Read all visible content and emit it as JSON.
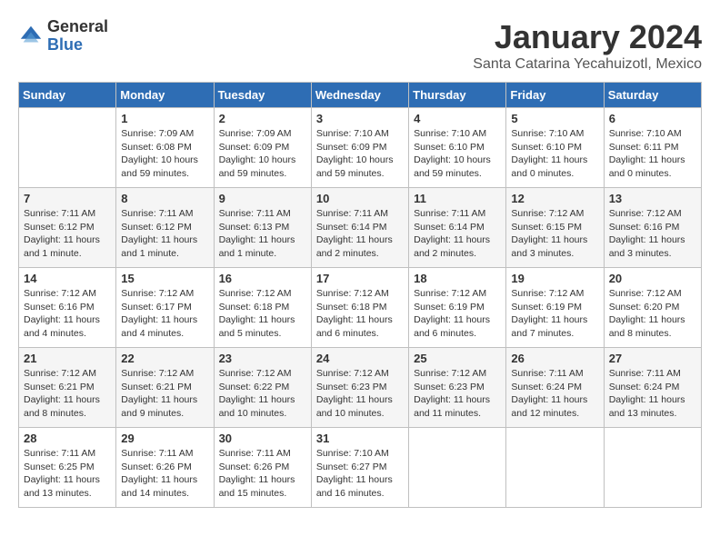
{
  "logo": {
    "general": "General",
    "blue": "Blue"
  },
  "header": {
    "month": "January 2024",
    "location": "Santa Catarina Yecahuizotl, Mexico"
  },
  "weekdays": [
    "Sunday",
    "Monday",
    "Tuesday",
    "Wednesday",
    "Thursday",
    "Friday",
    "Saturday"
  ],
  "weeks": [
    [
      {
        "day": "",
        "info": ""
      },
      {
        "day": "1",
        "info": "Sunrise: 7:09 AM\nSunset: 6:08 PM\nDaylight: 10 hours\nand 59 minutes."
      },
      {
        "day": "2",
        "info": "Sunrise: 7:09 AM\nSunset: 6:09 PM\nDaylight: 10 hours\nand 59 minutes."
      },
      {
        "day": "3",
        "info": "Sunrise: 7:10 AM\nSunset: 6:09 PM\nDaylight: 10 hours\nand 59 minutes."
      },
      {
        "day": "4",
        "info": "Sunrise: 7:10 AM\nSunset: 6:10 PM\nDaylight: 10 hours\nand 59 minutes."
      },
      {
        "day": "5",
        "info": "Sunrise: 7:10 AM\nSunset: 6:10 PM\nDaylight: 11 hours\nand 0 minutes."
      },
      {
        "day": "6",
        "info": "Sunrise: 7:10 AM\nSunset: 6:11 PM\nDaylight: 11 hours\nand 0 minutes."
      }
    ],
    [
      {
        "day": "7",
        "info": "Sunrise: 7:11 AM\nSunset: 6:12 PM\nDaylight: 11 hours\nand 1 minute."
      },
      {
        "day": "8",
        "info": "Sunrise: 7:11 AM\nSunset: 6:12 PM\nDaylight: 11 hours\nand 1 minute."
      },
      {
        "day": "9",
        "info": "Sunrise: 7:11 AM\nSunset: 6:13 PM\nDaylight: 11 hours\nand 1 minute."
      },
      {
        "day": "10",
        "info": "Sunrise: 7:11 AM\nSunset: 6:14 PM\nDaylight: 11 hours\nand 2 minutes."
      },
      {
        "day": "11",
        "info": "Sunrise: 7:11 AM\nSunset: 6:14 PM\nDaylight: 11 hours\nand 2 minutes."
      },
      {
        "day": "12",
        "info": "Sunrise: 7:12 AM\nSunset: 6:15 PM\nDaylight: 11 hours\nand 3 minutes."
      },
      {
        "day": "13",
        "info": "Sunrise: 7:12 AM\nSunset: 6:16 PM\nDaylight: 11 hours\nand 3 minutes."
      }
    ],
    [
      {
        "day": "14",
        "info": "Sunrise: 7:12 AM\nSunset: 6:16 PM\nDaylight: 11 hours\nand 4 minutes."
      },
      {
        "day": "15",
        "info": "Sunrise: 7:12 AM\nSunset: 6:17 PM\nDaylight: 11 hours\nand 4 minutes."
      },
      {
        "day": "16",
        "info": "Sunrise: 7:12 AM\nSunset: 6:18 PM\nDaylight: 11 hours\nand 5 minutes."
      },
      {
        "day": "17",
        "info": "Sunrise: 7:12 AM\nSunset: 6:18 PM\nDaylight: 11 hours\nand 6 minutes."
      },
      {
        "day": "18",
        "info": "Sunrise: 7:12 AM\nSunset: 6:19 PM\nDaylight: 11 hours\nand 6 minutes."
      },
      {
        "day": "19",
        "info": "Sunrise: 7:12 AM\nSunset: 6:19 PM\nDaylight: 11 hours\nand 7 minutes."
      },
      {
        "day": "20",
        "info": "Sunrise: 7:12 AM\nSunset: 6:20 PM\nDaylight: 11 hours\nand 8 minutes."
      }
    ],
    [
      {
        "day": "21",
        "info": "Sunrise: 7:12 AM\nSunset: 6:21 PM\nDaylight: 11 hours\nand 8 minutes."
      },
      {
        "day": "22",
        "info": "Sunrise: 7:12 AM\nSunset: 6:21 PM\nDaylight: 11 hours\nand 9 minutes."
      },
      {
        "day": "23",
        "info": "Sunrise: 7:12 AM\nSunset: 6:22 PM\nDaylight: 11 hours\nand 10 minutes."
      },
      {
        "day": "24",
        "info": "Sunrise: 7:12 AM\nSunset: 6:23 PM\nDaylight: 11 hours\nand 10 minutes."
      },
      {
        "day": "25",
        "info": "Sunrise: 7:12 AM\nSunset: 6:23 PM\nDaylight: 11 hours\nand 11 minutes."
      },
      {
        "day": "26",
        "info": "Sunrise: 7:11 AM\nSunset: 6:24 PM\nDaylight: 11 hours\nand 12 minutes."
      },
      {
        "day": "27",
        "info": "Sunrise: 7:11 AM\nSunset: 6:24 PM\nDaylight: 11 hours\nand 13 minutes."
      }
    ],
    [
      {
        "day": "28",
        "info": "Sunrise: 7:11 AM\nSunset: 6:25 PM\nDaylight: 11 hours\nand 13 minutes."
      },
      {
        "day": "29",
        "info": "Sunrise: 7:11 AM\nSunset: 6:26 PM\nDaylight: 11 hours\nand 14 minutes."
      },
      {
        "day": "30",
        "info": "Sunrise: 7:11 AM\nSunset: 6:26 PM\nDaylight: 11 hours\nand 15 minutes."
      },
      {
        "day": "31",
        "info": "Sunrise: 7:10 AM\nSunset: 6:27 PM\nDaylight: 11 hours\nand 16 minutes."
      },
      {
        "day": "",
        "info": ""
      },
      {
        "day": "",
        "info": ""
      },
      {
        "day": "",
        "info": ""
      }
    ]
  ]
}
